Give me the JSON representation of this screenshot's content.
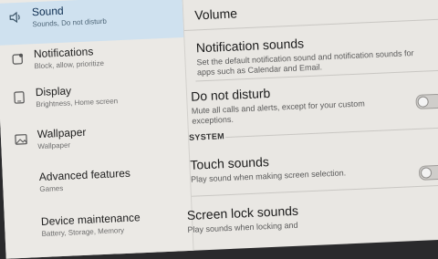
{
  "sidebar": {
    "items": [
      {
        "title": "Sound",
        "subtitle": "Sounds, Do not disturb",
        "icon": "speaker-icon",
        "selected": true
      },
      {
        "title": "Notifications",
        "subtitle": "Block, allow, prioritize",
        "icon": "notification-icon",
        "selected": false
      },
      {
        "title": "Display",
        "subtitle": "Brightness, Home screen",
        "icon": "display-icon",
        "selected": false
      },
      {
        "title": "Wallpaper",
        "subtitle": "Wallpaper",
        "icon": "wallpaper-icon",
        "selected": false
      },
      {
        "title": "Advanced features",
        "subtitle": "Games",
        "icon": "advanced-features-icon",
        "selected": false
      },
      {
        "title": "Device maintenance",
        "subtitle": "Battery, Storage, Memory",
        "icon": "device-maintenance-icon",
        "selected": false
      }
    ]
  },
  "main": {
    "volume": {
      "title": "Volume"
    },
    "notification_sounds": {
      "title": "Notification sounds",
      "subtitle": "Set the default notification sound and notification sounds for apps such as Calendar and Email."
    },
    "do_not_disturb": {
      "title": "Do not disturb",
      "subtitle": "Mute all calls and alerts, except for your custom exceptions.",
      "enabled": false
    },
    "section_system": "SYSTEM",
    "touch_sounds": {
      "title": "Touch sounds",
      "subtitle": "Play sound when making screen selection.",
      "enabled": false
    },
    "screen_lock_sounds": {
      "title": "Screen lock sounds",
      "subtitle": "Play sounds when locking and"
    }
  },
  "colors": {
    "selected_bg": "#cfe1ef",
    "background": "#e9e7e3"
  }
}
